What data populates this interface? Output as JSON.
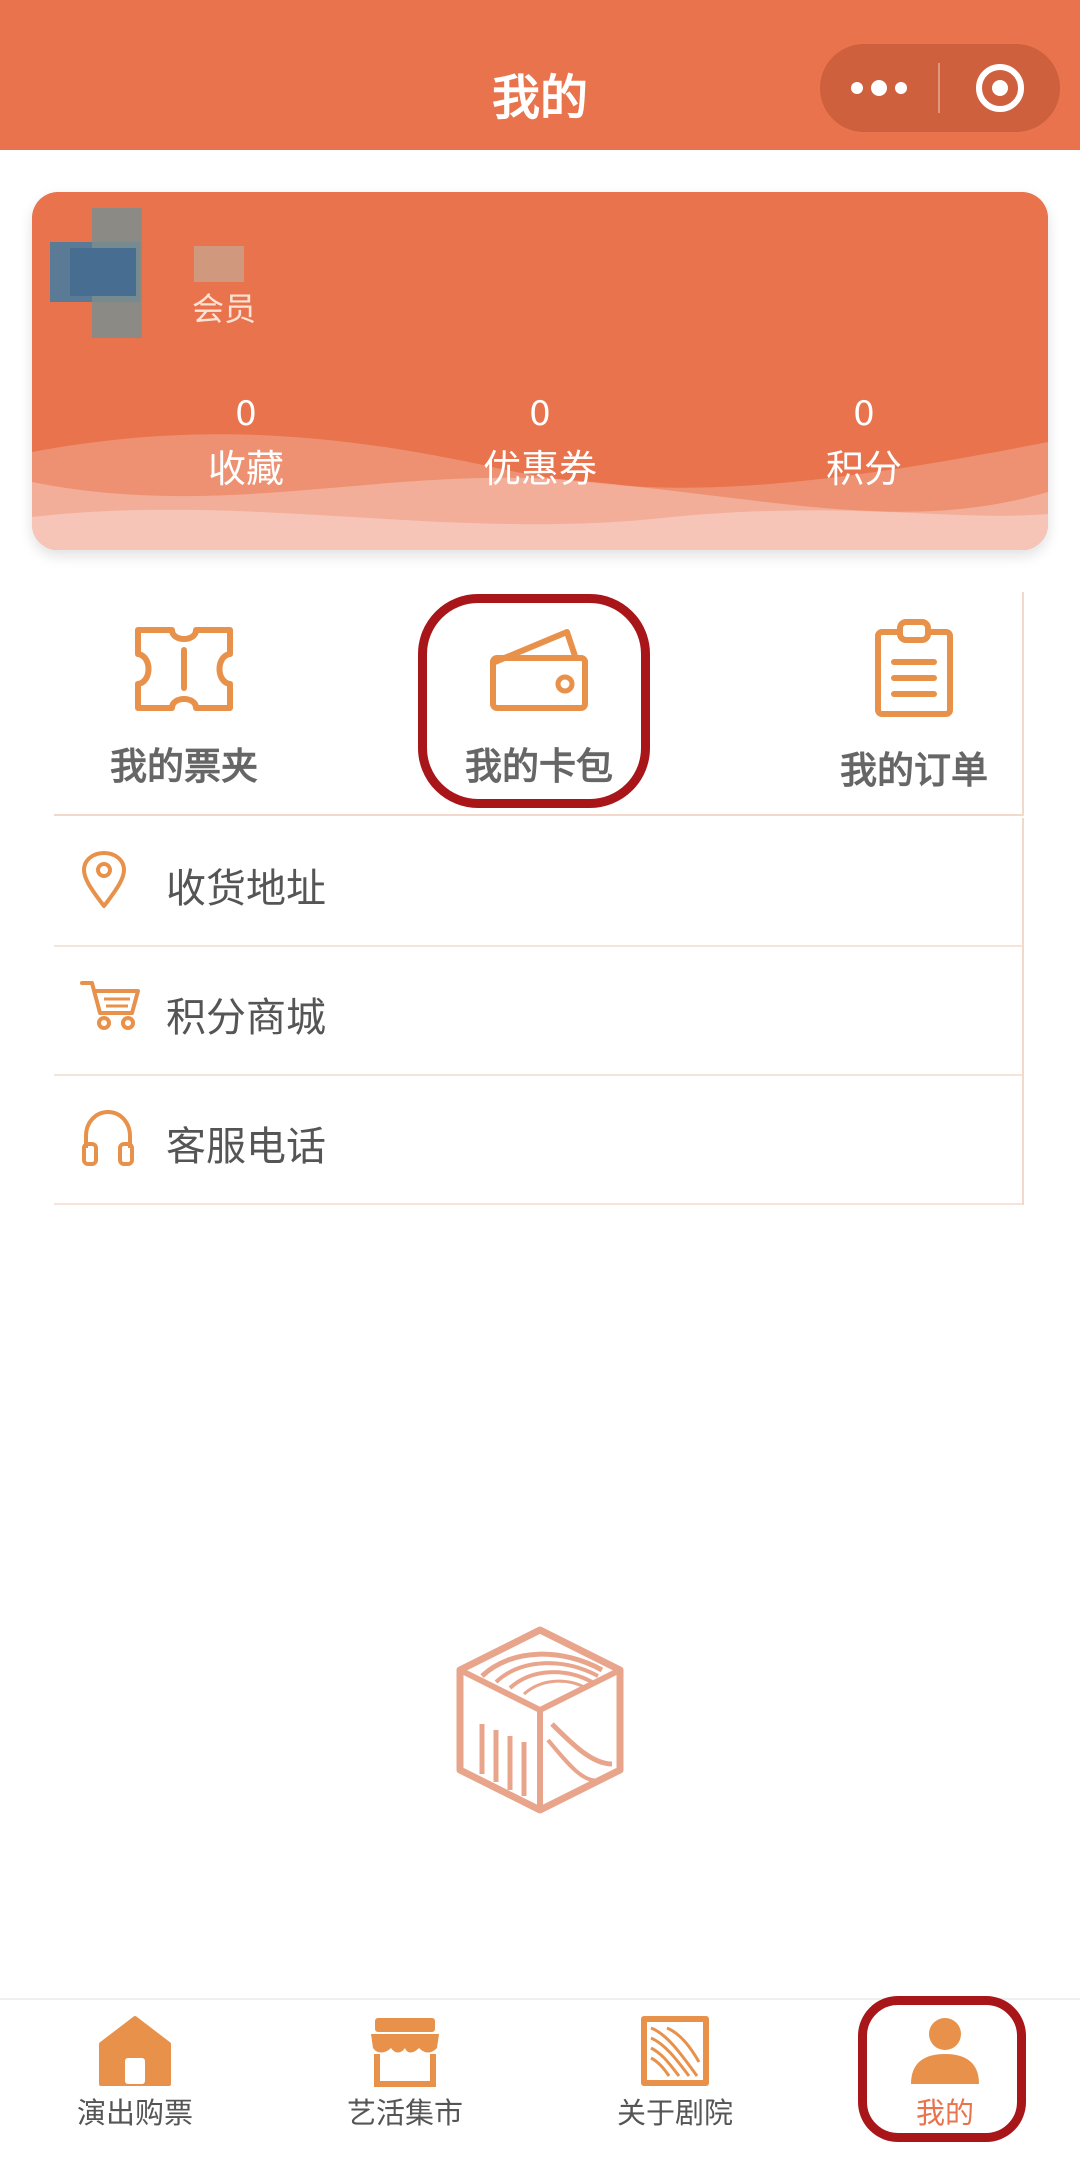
{
  "header": {
    "title": "我的"
  },
  "member_card": {
    "member_label": "会员",
    "stats": [
      {
        "value": "0",
        "label": "收藏"
      },
      {
        "value": "0",
        "label": "优惠券"
      },
      {
        "value": "0",
        "label": "积分"
      }
    ]
  },
  "quick_actions": [
    {
      "label": "我的票夹",
      "icon": "ticket-icon"
    },
    {
      "label": "我的卡包",
      "icon": "wallet-icon"
    },
    {
      "label": "我的订单",
      "icon": "clipboard-icon"
    }
  ],
  "menu": [
    {
      "label": "收货地址",
      "icon": "location-pin-icon"
    },
    {
      "label": "积分商城",
      "icon": "cart-icon"
    },
    {
      "label": "客服电话",
      "icon": "headphones-icon"
    }
  ],
  "tabbar": {
    "active": "我的",
    "items": [
      {
        "label": "演出购票",
        "icon": "home-icon"
      },
      {
        "label": "艺活集市",
        "icon": "store-icon"
      },
      {
        "label": "关于剧院",
        "icon": "theatre-icon"
      },
      {
        "label": "我的",
        "icon": "user-icon"
      }
    ]
  },
  "colors": {
    "accent": "#E8734C",
    "icon": "#E8914A",
    "highlight": "#A8161A"
  }
}
